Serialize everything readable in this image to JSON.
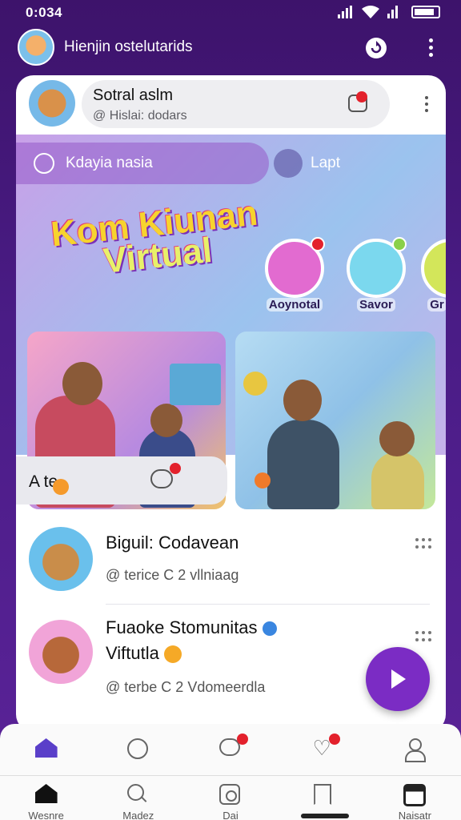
{
  "status": {
    "time": "0:034"
  },
  "header": {
    "title": "Hienjin ostelutarids"
  },
  "profile": {
    "name": "Sotral aslm",
    "subtitle": "@ Hislai: dodars"
  },
  "hero": {
    "tab_left": "Kdayia nasia",
    "tab_right": "Lapt",
    "banner_line1": "Kom Kiunan",
    "banner_line2": "Virtual",
    "people": [
      {
        "name": "Aoynotal",
        "color": "#e26bd0",
        "mark": "#e3212c"
      },
      {
        "name": "Savor",
        "color": "#7bd8ee",
        "mark": "#8ad04a"
      },
      {
        "name": "Gr",
        "color": "#d3e65a",
        "mark": "#f5a927"
      }
    ]
  },
  "actions": {
    "label": "A te"
  },
  "feed": [
    {
      "title": "Biguil: Codavean",
      "subtitle": "@ terice C 2 vllniaag",
      "avatar_color": "#6ac0ec"
    },
    {
      "title_line1": "Fuaoke Stomunitas",
      "title_line2": "Viftutla",
      "subtitle": "@ terbe C 2 Vdomeerdla",
      "avatar_color": "#f1a4d8"
    }
  ],
  "nav_top": [
    {
      "id": "home",
      "icon": "home-icon"
    },
    {
      "id": "explore",
      "icon": "search-bubble-icon"
    },
    {
      "id": "chat",
      "icon": "chat-icon",
      "badge": true
    },
    {
      "id": "likes",
      "icon": "heart-icon",
      "badge": true
    },
    {
      "id": "profile",
      "icon": "user-icon"
    }
  ],
  "nav_bottom": [
    {
      "label": "Wesnre",
      "icon": "home-icon"
    },
    {
      "label": "Madez",
      "icon": "search-icon"
    },
    {
      "label": "Dai",
      "icon": "camera-icon"
    },
    {
      "label": "",
      "icon": "bookmark-icon"
    },
    {
      "label": "Naisatr",
      "icon": "profile-square-icon"
    }
  ],
  "colors": {
    "accent": "#7b2cc4",
    "header_bg": "#3d136b",
    "badge": "#e3212c"
  }
}
